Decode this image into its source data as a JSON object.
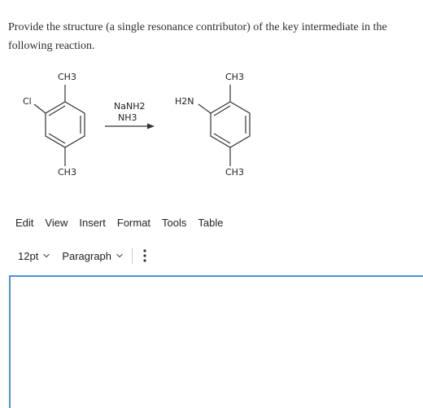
{
  "question": {
    "text": "Provide the structure (a single resonance contributor) of the key intermediate in the following reaction."
  },
  "reaction": {
    "reactant": {
      "top_substituent": "CH3",
      "left_substituent": "Cl",
      "bottom_substituent": "CH3"
    },
    "reagents": [
      "NaNH2",
      "NH3"
    ],
    "product": {
      "top_substituent": "CH3",
      "left_substituent": "H2N",
      "bottom_substituent": "CH3"
    }
  },
  "menubar": {
    "items": [
      "Edit",
      "View",
      "Insert",
      "Format",
      "Tools",
      "Table"
    ]
  },
  "toolbar": {
    "font_size": "12pt",
    "block_format": "Paragraph",
    "more_icon": "vertical-ellipsis-icon",
    "dropdown_icon": "chevron-down-icon"
  },
  "editor": {
    "content": "",
    "border_color": "#4c92d8"
  }
}
